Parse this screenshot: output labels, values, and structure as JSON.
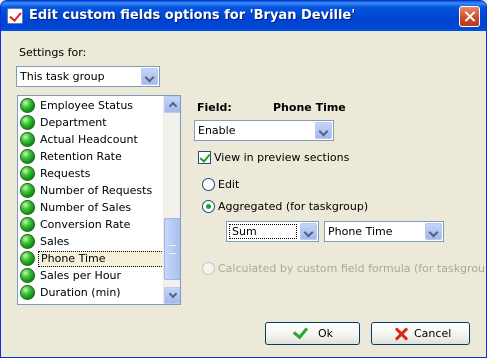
{
  "window": {
    "title": "Edit custom fields options for  'Bryan Deville'"
  },
  "settings": {
    "label": "Settings for:",
    "selected": "This task group"
  },
  "list": {
    "items": [
      {
        "label": "Employee Status"
      },
      {
        "label": "Department"
      },
      {
        "label": "Actual Headcount"
      },
      {
        "label": "Retention Rate"
      },
      {
        "label": "Requests"
      },
      {
        "label": "Number of Requests"
      },
      {
        "label": "Number of Sales"
      },
      {
        "label": "Conversion Rate"
      },
      {
        "label": "Sales"
      },
      {
        "label": "Phone Time"
      },
      {
        "label": "Sales per Hour"
      },
      {
        "label": "Duration (min)"
      }
    ],
    "selected_item": "Phone Time"
  },
  "field": {
    "label": "Field:",
    "name": "Phone Time",
    "mode_selected": "Enable",
    "view_in_preview_label": "View in preview sections",
    "view_in_preview_checked": true,
    "edit_label": "Edit",
    "aggregated_label": "Aggregated (for taskgroup)",
    "aggregate_function": "Sum",
    "aggregate_field": "Phone Time",
    "calculated_label": "Calculated by custom field formula (for taskgroup)"
  },
  "buttons": {
    "ok": "Ok",
    "cancel": "Cancel"
  },
  "colors": {
    "titlebar": "#0046d5",
    "dialog_bg": "#ece9d8",
    "check_green": "#21a121"
  }
}
